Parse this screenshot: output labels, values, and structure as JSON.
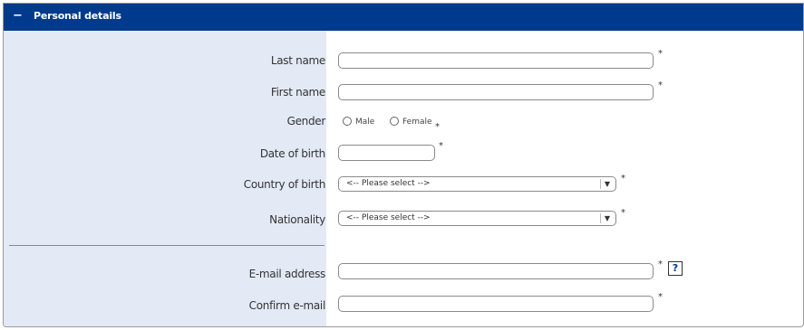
{
  "section": {
    "title": "Personal details",
    "collapse_icon": "−"
  },
  "fields": {
    "last_name": {
      "label": "Last name",
      "value": "",
      "required": "*"
    },
    "first_name": {
      "label": "First name",
      "value": "",
      "required": "*"
    },
    "gender": {
      "label": "Gender",
      "options": [
        "Male",
        "Female"
      ],
      "required": "*"
    },
    "date_of_birth": {
      "label": "Date of birth",
      "value": "",
      "required": "*"
    },
    "country_of_birth": {
      "label": "Country of birth",
      "selected": "<-- Please select -->",
      "required": "*"
    },
    "nationality": {
      "label": "Nationality",
      "selected": "<-- Please select -->",
      "required": "*"
    },
    "email": {
      "label": "E-mail address",
      "value": "",
      "required": "*"
    },
    "confirm_email": {
      "label": "Confirm e-mail",
      "value": "",
      "required": "*"
    }
  },
  "help": {
    "label": "?"
  },
  "icons": {
    "collapse": "minus-icon",
    "help": "question-mark-icon",
    "dropdown": "chevron-down-icon"
  },
  "colors": {
    "header_bg": "#003a8c",
    "label_column_bg": "#e3eaf5"
  }
}
